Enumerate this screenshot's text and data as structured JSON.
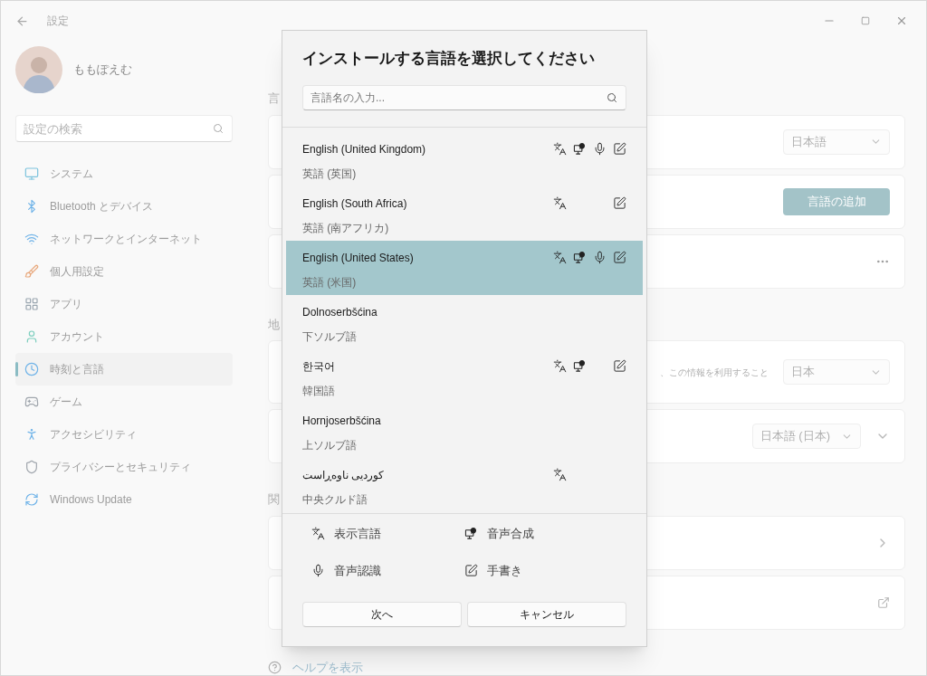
{
  "window": {
    "title": "設定"
  },
  "user": {
    "name": "ももぽえむ"
  },
  "search": {
    "placeholder": "設定の検索"
  },
  "nav": [
    {
      "label": "システム",
      "selected": false
    },
    {
      "label": "Bluetooth とデバイス",
      "selected": false
    },
    {
      "label": "ネットワークとインターネット",
      "selected": false
    },
    {
      "label": "個人用設定",
      "selected": false
    },
    {
      "label": "アプリ",
      "selected": false
    },
    {
      "label": "アカウント",
      "selected": false
    },
    {
      "label": "時刻と言語",
      "selected": true
    },
    {
      "label": "ゲーム",
      "selected": false
    },
    {
      "label": "アクセシビリティ",
      "selected": false
    },
    {
      "label": "プライバシーとセキュリティ",
      "selected": false
    },
    {
      "label": "Windows Update",
      "selected": false
    }
  ],
  "content": {
    "sections": [
      {
        "heading": "言",
        "cards": [
          {
            "kind": "dropdown",
            "value": "日本語"
          },
          {
            "kind": "button",
            "label": "言語の追加"
          },
          {
            "kind": "more"
          }
        ]
      },
      {
        "heading": "地",
        "cards": [
          {
            "kind": "dropdown",
            "text": "、この情報を利用すること",
            "value": "日本"
          },
          {
            "kind": "dropdown",
            "value": "日本語 (日本)",
            "expandable": true
          }
        ]
      },
      {
        "heading": "関",
        "cards": [
          {
            "kind": "link"
          },
          {
            "kind": "external"
          }
        ]
      }
    ],
    "help": "ヘルプを表示"
  },
  "dialog": {
    "title": "インストールする言語を選択してください",
    "search": {
      "placeholder": "言語名の入力..."
    },
    "languages": [
      {
        "name": "English (United Kingdom)",
        "subtitle": "英語 (英国)",
        "selected": false,
        "display": true,
        "tts": true,
        "speech": true,
        "handwriting": true
      },
      {
        "name": "English (South Africa)",
        "subtitle": "英語 (南アフリカ)",
        "selected": false,
        "display": true,
        "tts": false,
        "speech": false,
        "handwriting": true
      },
      {
        "name": "English (United States)",
        "subtitle": "英語 (米国)",
        "selected": true,
        "display": true,
        "tts": true,
        "speech": true,
        "handwriting": true
      },
      {
        "name": "Dolnoserbšćina",
        "subtitle": "下ソルブ語",
        "selected": false,
        "display": false,
        "tts": false,
        "speech": false,
        "handwriting": false
      },
      {
        "name": "한국어",
        "subtitle": "韓国語",
        "selected": false,
        "display": true,
        "tts": true,
        "speech": false,
        "handwriting": true
      },
      {
        "name": "Hornjoserbšćina",
        "subtitle": "上ソルブ語",
        "selected": false,
        "display": false,
        "tts": false,
        "speech": false,
        "handwriting": false
      },
      {
        "name": "کوردیی ناوەڕاست",
        "subtitle": "中央クルド語",
        "selected": false,
        "display": true,
        "tts": false,
        "speech": false,
        "handwriting": false
      }
    ],
    "legend": [
      {
        "kind": "display",
        "label": "表示言語"
      },
      {
        "kind": "tts",
        "label": "音声合成"
      },
      {
        "kind": "speech",
        "label": "音声認識"
      },
      {
        "kind": "handwriting",
        "label": "手書き"
      }
    ],
    "buttons": [
      "次へ",
      "キャンセル"
    ]
  }
}
